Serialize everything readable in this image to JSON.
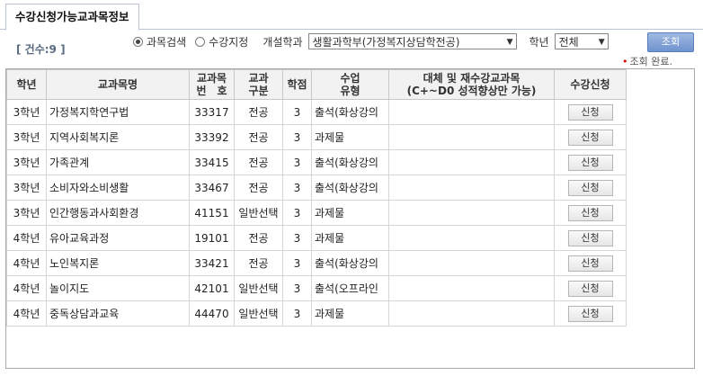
{
  "tab": {
    "label": "수강신청가능교과목정보"
  },
  "count_label": "[ 건수:9 ]",
  "filters": {
    "radio_subject": "과목검색",
    "radio_registered": "수강지정",
    "dept_label": "개설학과",
    "dept_value": "생활과학부(가정복지상담학전공)",
    "year_label": "학년",
    "year_value": "전체",
    "search_button": "조회"
  },
  "status": "조회 완료.",
  "table": {
    "headers": {
      "year": "학년",
      "name": "교과목명",
      "code_line1": "교과목",
      "code_line2": "번　호",
      "type_line1": "교과",
      "type_line2": "구분",
      "credit": "학점",
      "method_line1": "수업",
      "method_line2": "유형",
      "replace_line1": "대체 및 재수강교과목",
      "replace_line2": "(C+~D0 성적향상만 가능)",
      "apply": "수강신청"
    },
    "apply_label": "신청",
    "rows": [
      {
        "year": "3학년",
        "name": "가정복지학연구법",
        "code": "33317",
        "type": "전공",
        "credit": "3",
        "method": "출석(화상강의",
        "replace": ""
      },
      {
        "year": "3학년",
        "name": "지역사회복지론",
        "code": "33392",
        "type": "전공",
        "credit": "3",
        "method": "과제물",
        "replace": ""
      },
      {
        "year": "3학년",
        "name": "가족관계",
        "code": "33415",
        "type": "전공",
        "credit": "3",
        "method": "출석(화상강의",
        "replace": ""
      },
      {
        "year": "3학년",
        "name": "소비자와소비생활",
        "code": "33467",
        "type": "전공",
        "credit": "3",
        "method": "출석(화상강의",
        "replace": ""
      },
      {
        "year": "3학년",
        "name": "인간행동과사회환경",
        "code": "41151",
        "type": "일반선택",
        "credit": "3",
        "method": "과제물",
        "replace": ""
      },
      {
        "year": "4학년",
        "name": "유아교육과정",
        "code": "19101",
        "type": "전공",
        "credit": "3",
        "method": "과제물",
        "replace": ""
      },
      {
        "year": "4학년",
        "name": "노인복지론",
        "code": "33421",
        "type": "전공",
        "credit": "3",
        "method": "출석(화상강의",
        "replace": ""
      },
      {
        "year": "4학년",
        "name": "놀이지도",
        "code": "42101",
        "type": "일반선택",
        "credit": "3",
        "method": "출석(오프라인",
        "replace": ""
      },
      {
        "year": "4학년",
        "name": "중독상담과교육",
        "code": "44470",
        "type": "일반선택",
        "credit": "3",
        "method": "과제물",
        "replace": ""
      }
    ]
  }
}
